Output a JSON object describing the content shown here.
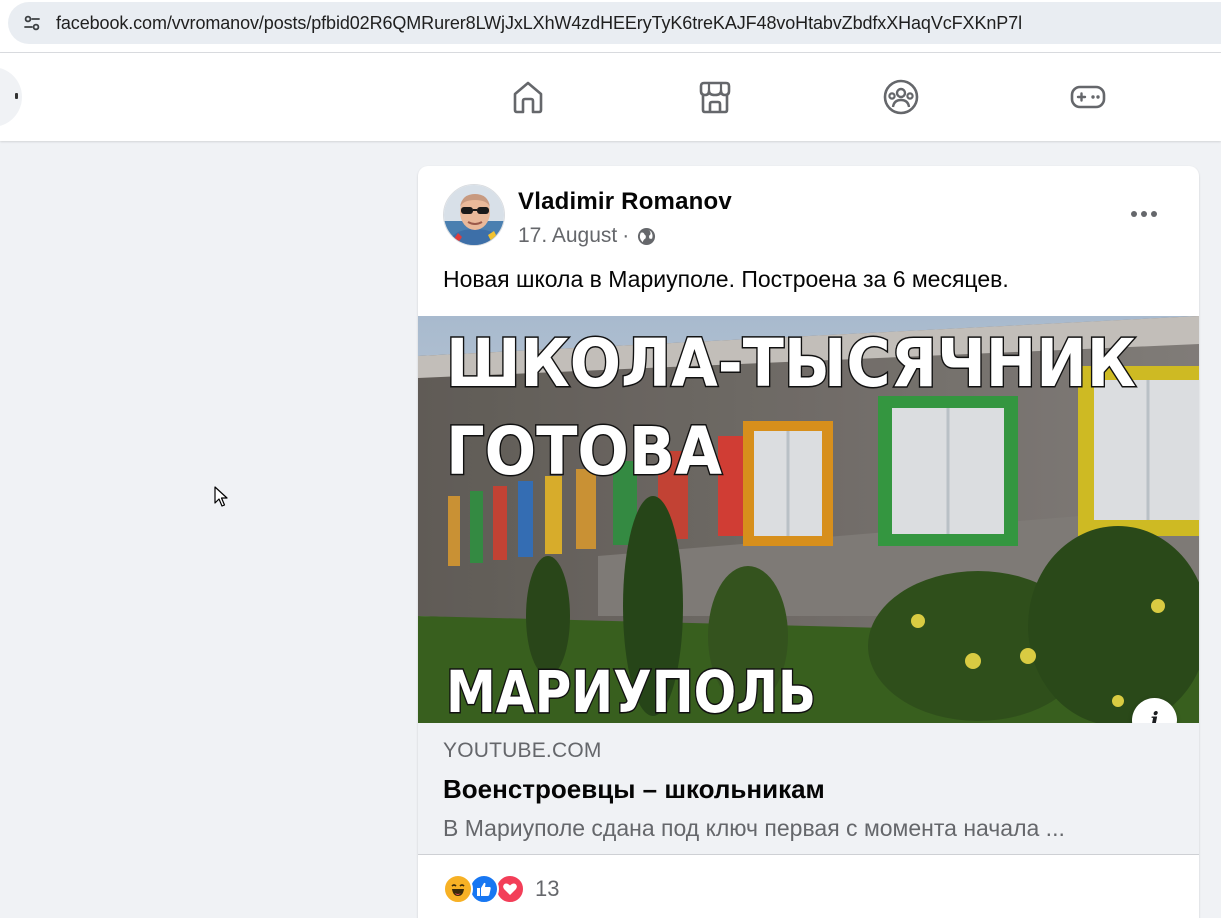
{
  "browser": {
    "url": "facebook.com/vvromanov/posts/pfbid02R6QMRurer8LWjJxLXhW4zdHEEryTyK6treKAJF48voHtabvZbdfxXHaqVcFXKnP7l",
    "site_info_icon": "tune-icon"
  },
  "nav": {
    "tabs": [
      {
        "icon": "home-icon"
      },
      {
        "icon": "marketplace-icon"
      },
      {
        "icon": "groups-icon"
      },
      {
        "icon": "gaming-icon"
      }
    ]
  },
  "post": {
    "author": "Vladimir Romanov",
    "date": "17. August",
    "separator": "·",
    "privacy_icon": "globe-icon",
    "text": "Новая школа в Мариуполе. Построена за 6 месяцев.",
    "thumbnail": {
      "line1": "ШКОЛА-ТЫСЯЧНИК",
      "line2": "ГОТОВА",
      "line3": "МАРИУПОЛЬ"
    },
    "link": {
      "domain": "YOUTUBE.COM",
      "title": "Военстроевцы – школьникам",
      "description": "В Мариуполе сдана под ключ первая с момента начала ..."
    },
    "reactions": {
      "types": [
        "haha",
        "like",
        "love"
      ],
      "count": "13"
    }
  },
  "colors": {
    "brand": "#1877f2",
    "page_bg": "#f0f2f5",
    "secondary_text": "#65676b"
  }
}
